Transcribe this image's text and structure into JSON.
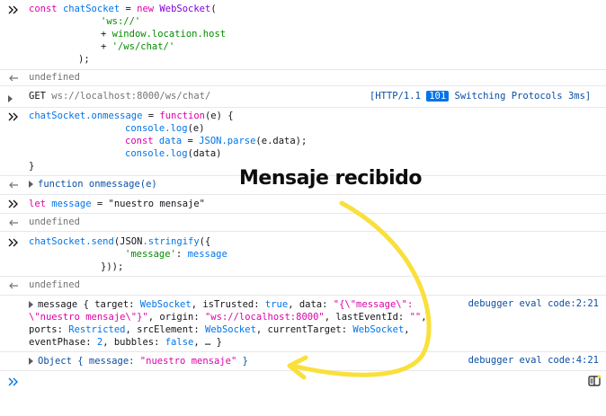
{
  "block1": {
    "prompt_icon": "double-chevron-right-icon",
    "l1_kw": "const",
    "l1_var": "chatSocket",
    "l1_eq": " = ",
    "l1_new": "new",
    "l1_cls": "WebSocket",
    "l1_paren": "(",
    "l2": "'ws://'",
    "l3_plus": "+ ",
    "l3_expr": "window.location.host",
    "l4_plus": "+ ",
    "l4_str": "'/ws/chat/'",
    "l5": ");"
  },
  "result1": {
    "icon": "return-arrow-icon",
    "text": "undefined"
  },
  "network": {
    "method": "GET",
    "url": "ws://localhost:8000/ws/chat/",
    "proto": "[HTTP/1.1 ",
    "status_code": "101",
    "status_text": " Switching Protocols 3ms]"
  },
  "block2": {
    "l1_obj": "chatSocket",
    "l1_prop": ".onmessage",
    "l1_eq": " = ",
    "l1_fn": "function",
    "l1_arg": "(e) {",
    "l2_a": "console",
    "l2_b": ".log",
    "l2_c": "(e)",
    "l3_kw": "const",
    "l3_var": " data",
    "l3_eq": " = ",
    "l3_json": "JSON",
    "l3_parse": ".parse",
    "l3_arg": "(e.data);",
    "l4_a": "console",
    "l4_b": ".log",
    "l4_c": "(data)",
    "l5": "}"
  },
  "result2": {
    "text": "function onmessage(e)"
  },
  "annotation": {
    "text": "Mensaje recibido"
  },
  "block3": {
    "kw": "let",
    "var": " message",
    "eq": " = ",
    "str": "\"nuestro mensaje\""
  },
  "result3": {
    "text": "undefined"
  },
  "block4": {
    "l1_obj": "chatSocket",
    "l1_send": ".send",
    "l1_json": "(JSON",
    "l1_str": ".stringify",
    "l1_open": "({",
    "l2_key": "'message'",
    "l2_colon": ": ",
    "l2_val": "message",
    "l3": "}));"
  },
  "result4": {
    "text": "undefined"
  },
  "log1": {
    "line1_a": "message { target: ",
    "line1_b": "WebSocket",
    "line1_c": ", isTrusted: ",
    "line1_d": "true",
    "line1_e": ", data: ",
    "line1_f": "\"{\\\"message\\\":",
    "line2_a": "\\\"nuestro mensaje\\\"}\"",
    "line2_b": ", origin: ",
    "line2_c": "\"ws://localhost:8000\"",
    "line2_d": ", lastEventId: ",
    "line2_e": "\"\"",
    "line2_f": ",",
    "line3_a": "ports: ",
    "line3_b": "Restricted",
    "line3_c": ", srcElement: ",
    "line3_d": "WebSocket",
    "line3_e": ", currentTarget: ",
    "line3_f": "WebSocket",
    "line3_g": ",",
    "line4_a": "eventPhase: ",
    "line4_b": "2",
    "line4_c": ", bubbles: ",
    "line4_d": "false",
    "line4_e": ", … }",
    "source": "debugger eval code:2:21"
  },
  "log2": {
    "a": "Object { message: ",
    "b": "\"nuestro mensaje\"",
    "c": " }",
    "source": "debugger eval code:4:21"
  },
  "input": {
    "prompt_icon": "double-chevron-right-icon",
    "value": ""
  },
  "sidebar_toggle": {
    "icon": "split-panel-icon"
  },
  "colors": {
    "annotation_arrow": "#f9e03b",
    "keyword": "#dd00a9",
    "string": "#058b00",
    "identifier": "#0074e8",
    "function": "#8000d7"
  }
}
